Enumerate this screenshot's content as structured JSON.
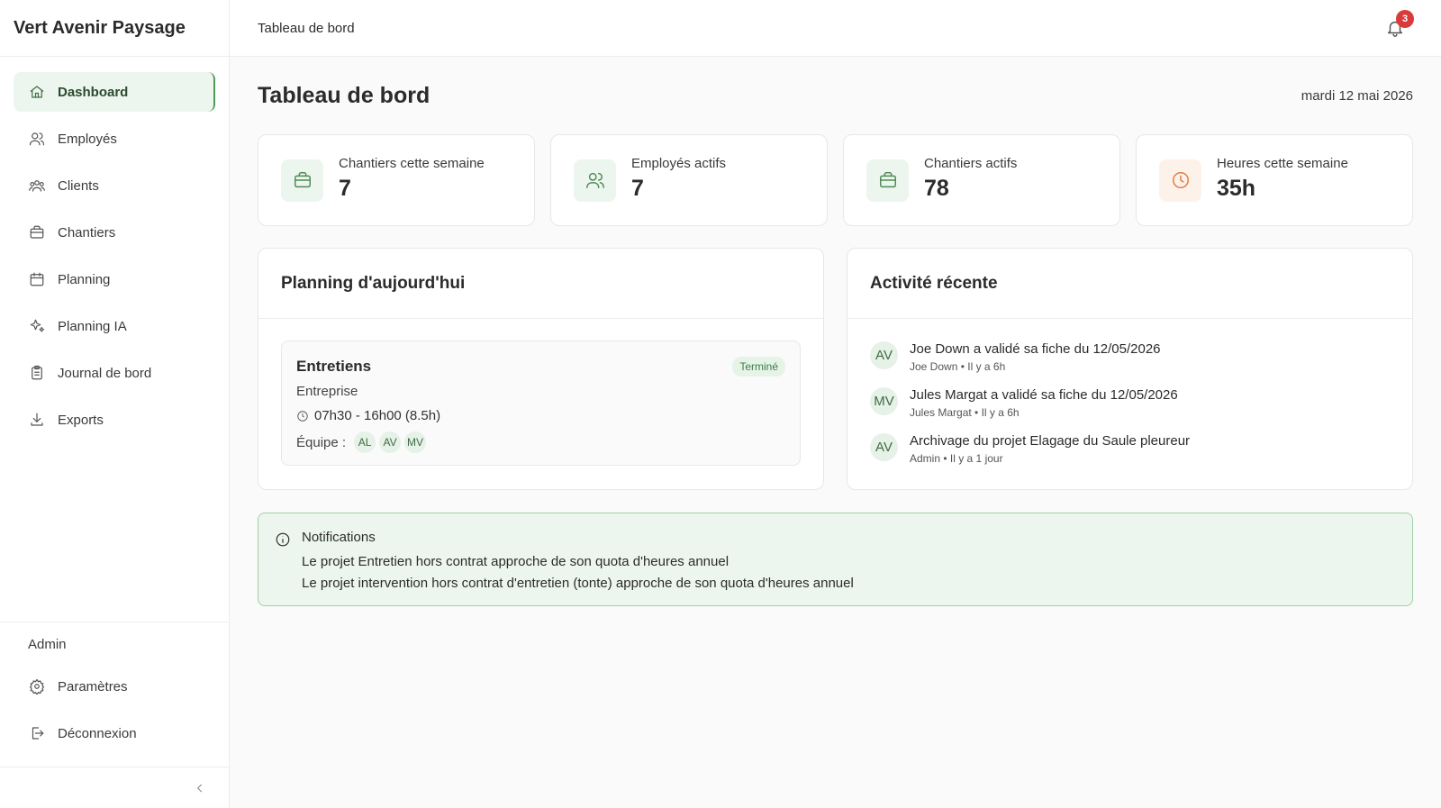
{
  "app": {
    "brand": "Vert Avenir Paysage"
  },
  "header": {
    "breadcrumb": "Tableau de bord",
    "notification_count": "3"
  },
  "sidebar": {
    "items": [
      {
        "label": "Dashboard",
        "icon": "home-icon"
      },
      {
        "label": "Employés",
        "icon": "users-icon"
      },
      {
        "label": "Clients",
        "icon": "clients-icon"
      },
      {
        "label": "Chantiers",
        "icon": "briefcase-icon"
      },
      {
        "label": "Planning",
        "icon": "calendar-icon"
      },
      {
        "label": "Planning IA",
        "icon": "sparkles-icon"
      },
      {
        "label": "Journal de bord",
        "icon": "clipboard-icon"
      },
      {
        "label": "Exports",
        "icon": "download-icon"
      }
    ],
    "admin_title": "Admin",
    "admin_items": [
      {
        "label": "Paramètres",
        "icon": "settings-icon"
      },
      {
        "label": "Déconnexion",
        "icon": "logout-icon"
      }
    ]
  },
  "page": {
    "title": "Tableau de bord",
    "date": "mardi 12 mai 2026"
  },
  "stats": [
    {
      "label": "Chantiers cette semaine",
      "value": "7",
      "icon": "briefcase-icon"
    },
    {
      "label": "Employés actifs",
      "value": "7",
      "icon": "users-icon"
    },
    {
      "label": "Chantiers actifs",
      "value": "78",
      "icon": "briefcase-icon"
    },
    {
      "label": "Heures cette semaine",
      "value": "35h",
      "icon": "clock-icon"
    }
  ],
  "planning": {
    "title": "Planning d'aujourd'hui",
    "job": {
      "title": "Entretiens",
      "client": "Entreprise",
      "time": "07h30 - 16h00 (8.5h)",
      "team_label": "Équipe :",
      "team": [
        "AL",
        "AV",
        "MV"
      ],
      "status": "Terminé"
    }
  },
  "activity": {
    "title": "Activité récente",
    "items": [
      {
        "avatar": "AV",
        "text": "Joe Down a validé sa fiche du 12/05/2026",
        "meta": "Joe Down • Il y a 6h"
      },
      {
        "avatar": "MV",
        "text": "Jules Margat a validé sa fiche du 12/05/2026",
        "meta": "Jules Margat • Il y a 6h"
      },
      {
        "avatar": "AV",
        "text": "Archivage du projet Elagage du Saule pleureur",
        "meta": "Admin • Il y a 1 jour"
      }
    ]
  },
  "notifications": {
    "title": "Notifications",
    "lines": [
      "Le projet Entretien hors contrat approche de son quota d'heures annuel",
      "Le projet intervention hors contrat d'entretien (tonte) approche de son quota d'heures annuel"
    ]
  },
  "colors": {
    "accent": "#4f9a5a",
    "accent_bg": "#edf6ee",
    "badge": "#d93a3a",
    "clock_accent": "#e07a45"
  }
}
